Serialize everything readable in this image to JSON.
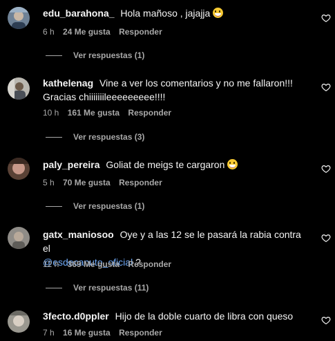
{
  "comments": [
    {
      "username": "edu_barahona_",
      "text": "Hola mañoso , jajajja",
      "time": "6 h",
      "likes": "24 Me gusta",
      "reply": "Responder",
      "view_replies": "Ver respuestas (1)"
    },
    {
      "username": "kathelenag",
      "text": "Vine a ver los comentarios y no me fallaron!!! Gracias chiiiiiiileeeeeeeee!!!!",
      "time": "10 h",
      "likes": "161 Me gusta",
      "reply": "Responder",
      "view_replies": "Ver respuestas (3)"
    },
    {
      "username": "paly_pereira",
      "text": "Goliat de meigs te cargaron",
      "time": "5 h",
      "likes": "70 Me gusta",
      "reply": "Responder",
      "view_replies": "Ver respuestas (1)"
    },
    {
      "username": "gatx_maniosoo",
      "text": "Oye y a las 12 se le pasará la rabia contra el",
      "mention": "@esdecanuto_oficial",
      "text_after": " ?",
      "time": "12 h",
      "likes": "369 Me gusta",
      "reply": "Responder",
      "view_replies": "Ver respuestas (11)"
    },
    {
      "username": "3fecto.d0ppler",
      "text": "Hijo de la doble cuarto de libra con queso",
      "time": "7 h",
      "likes": "16 Me gusta",
      "reply": "Responder"
    }
  ],
  "icons": {
    "like": "heart-outline-icon",
    "emoji": "grinning-face-emoji"
  },
  "colors": {
    "background": "#000000",
    "secondary_text": "#a8a8a8",
    "mention": "#6ea8f5"
  }
}
